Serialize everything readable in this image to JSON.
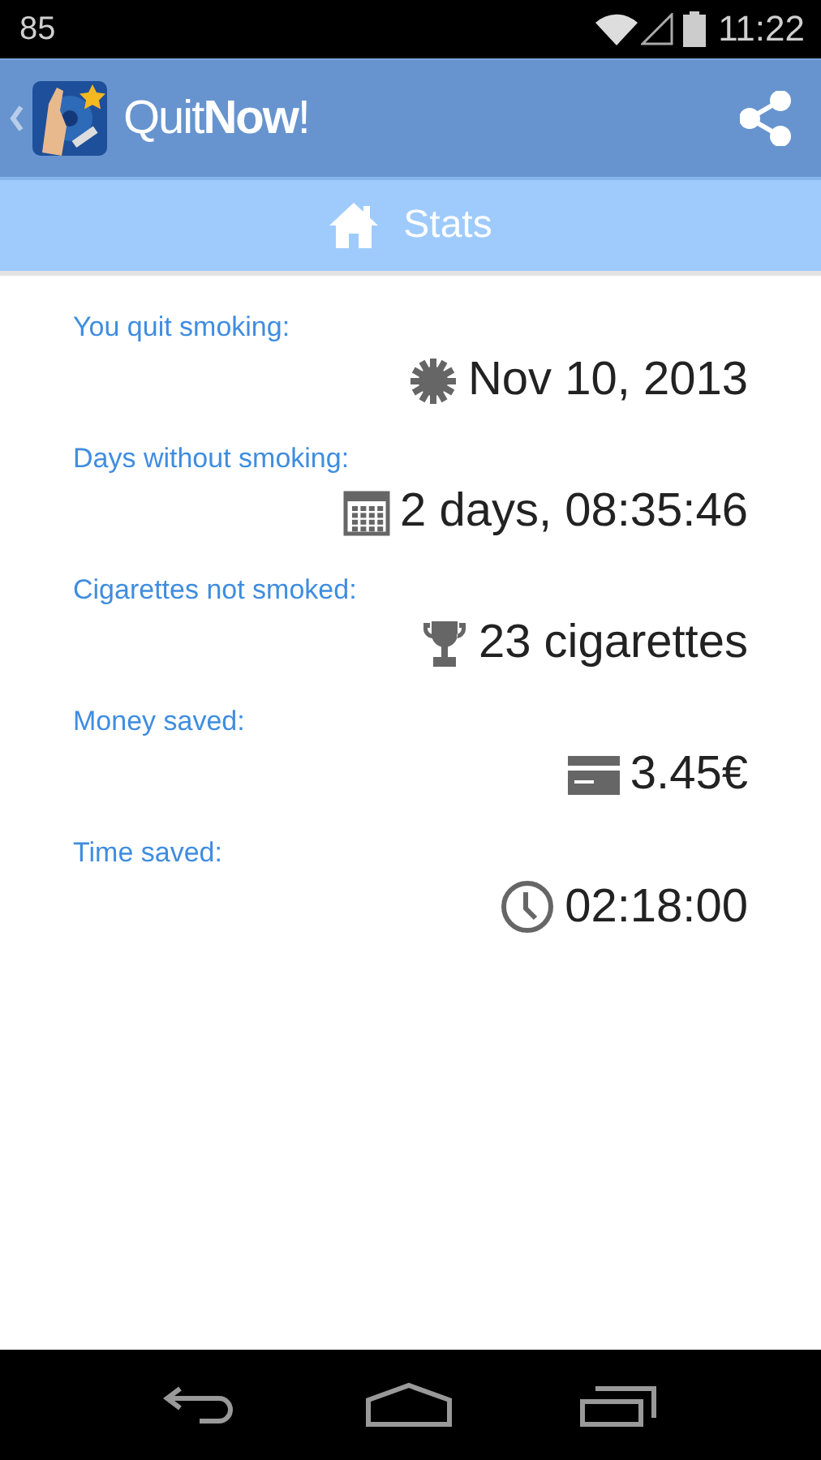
{
  "status_bar": {
    "notification": "85",
    "time": "11:22"
  },
  "app_bar": {
    "title": "Quit**Now**!"
  },
  "section": {
    "label": "Stats"
  },
  "stats": [
    {
      "label": "You quit smoking:",
      "value": "Nov 10, 2013",
      "kind": "date"
    },
    {
      "label": "Days without smoking:",
      "value": "2 days, 08:35:46",
      "kind": "days"
    },
    {
      "label": "Cigarettes not smoked:",
      "value": "23 cigarettes",
      "kind": "cigarettes"
    },
    {
      "label": "Money saved:",
      "value": "3.45€",
      "kind": "money"
    },
    {
      "label": "Time saved:",
      "value": "02:18:00",
      "kind": "time"
    }
  ]
}
